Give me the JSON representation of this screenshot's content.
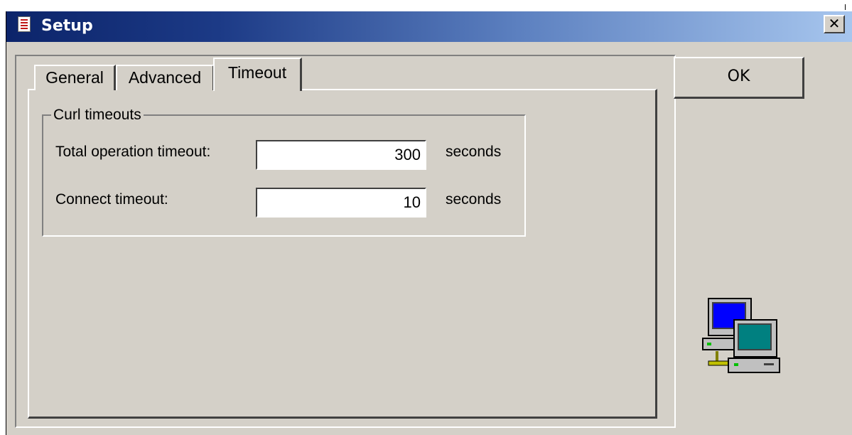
{
  "window": {
    "title": "Setup",
    "close_glyph": "✕"
  },
  "tabs": [
    {
      "label": "General",
      "active": false
    },
    {
      "label": "Advanced",
      "active": false
    },
    {
      "label": "Timeout",
      "active": true
    }
  ],
  "curl_timeouts": {
    "legend": "Curl timeouts",
    "total_operation": {
      "label": "Total operation timeout:",
      "value": "300",
      "unit": "seconds"
    },
    "connect": {
      "label": "Connect timeout:",
      "value": "10",
      "unit": "seconds"
    }
  },
  "buttons": {
    "ok_label": "OK"
  },
  "icons": {
    "title": "app-checklist-icon",
    "network": "network-computers-icon",
    "close": "close-icon"
  },
  "colors": {
    "titlebar_start": "#0c246a",
    "titlebar_end": "#a7c6ee",
    "dialog_face": "#d4d0c8"
  }
}
